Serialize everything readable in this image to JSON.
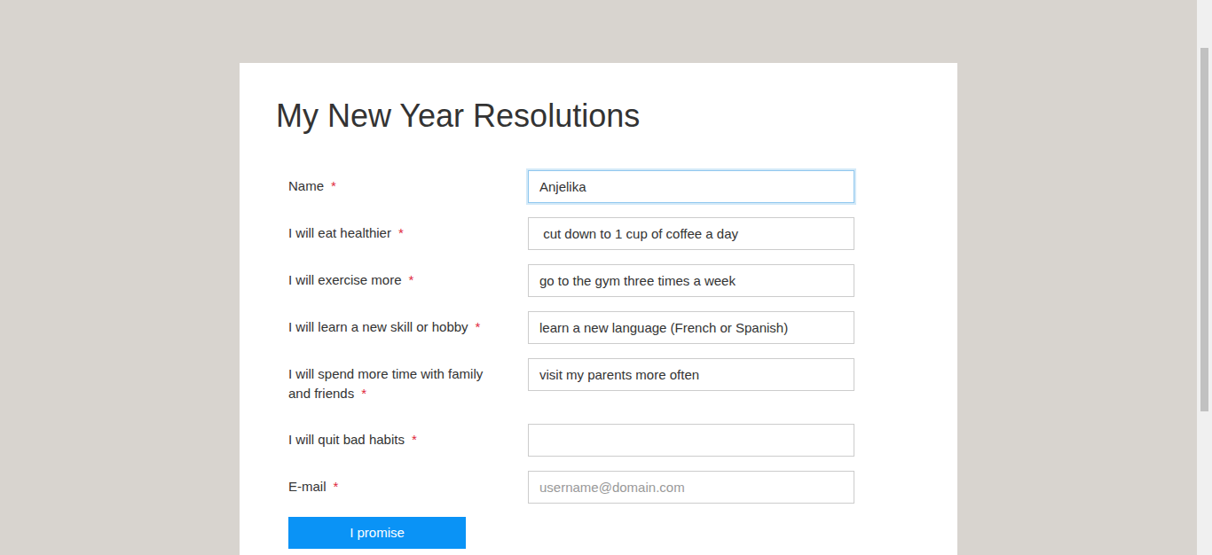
{
  "form": {
    "title": "My New Year Resolutions",
    "required_mark": "*",
    "fields": [
      {
        "label": "Name",
        "required": true,
        "value": "Anjelika",
        "placeholder": "",
        "focused": true
      },
      {
        "label": "I will eat healthier",
        "required": true,
        "value": " cut down to 1 cup of coffee a day",
        "placeholder": "",
        "focused": false
      },
      {
        "label": "I will exercise more",
        "required": true,
        "value": "go to the gym three times a week",
        "placeholder": "",
        "focused": false
      },
      {
        "label": "I will learn a new skill or hobby",
        "required": true,
        "value": "learn a new language (French or Spanish)",
        "placeholder": "",
        "focused": false
      },
      {
        "label": "I will spend more time with family and friends",
        "required": true,
        "value": "visit my parents more often",
        "placeholder": "",
        "focused": false
      },
      {
        "label": "I will quit bad habits",
        "required": true,
        "value": "",
        "placeholder": "",
        "focused": false
      },
      {
        "label": "E-mail",
        "required": true,
        "value": "",
        "placeholder": "username@domain.com",
        "focused": false
      }
    ],
    "submit_button": "I promise"
  }
}
